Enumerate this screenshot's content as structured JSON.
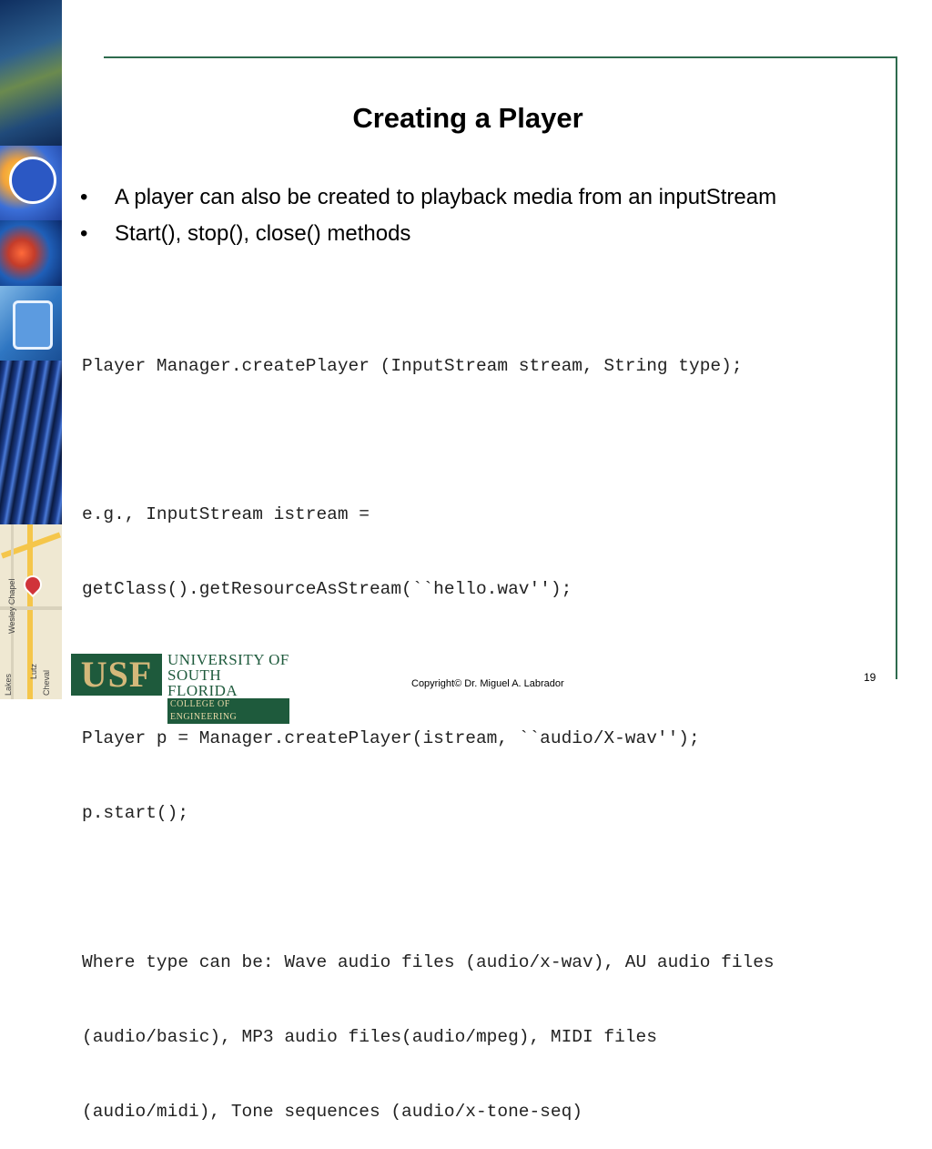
{
  "slide": {
    "title": "Creating a Player",
    "bullets": [
      "A player can also be created to playback media from an inputStream",
      "Start(), stop(), close() methods"
    ],
    "code_lines": [
      "Player Manager.createPlayer (InputStream stream, String type);",
      "",
      "e.g., InputStream istream =",
      "getClass().getResourceAsStream(``hello.wav'');",
      "",
      "Player p = Manager.createPlayer(istream, ``audio/X-wav'');",
      "p.start();",
      "",
      "Where type can be: Wave audio files (audio/x-wav), AU audio files",
      "(audio/basic), MP3 audio files(audio/mpeg), MIDI files",
      "(audio/midi), Tone sequences (audio/x-tone-seq)"
    ],
    "bullet_glyph": "•"
  },
  "footer": {
    "copyright": "Copyright© Dr. Miguel A. Labrador",
    "page_number": "19"
  },
  "logo": {
    "mark": "USF",
    "line1": "UNIVERSITY OF",
    "line2": "SOUTH FLORIDA",
    "line3": "COLLEGE OF ENGINEERING"
  },
  "side_strip": {
    "map_labels": [
      "Wesley Chapel",
      "Lutz",
      "Lakes",
      "Cheval"
    ],
    "icons": [
      "satellite-dish-icon",
      "brain-icon",
      "mobile-phone-icon",
      "circuit-board-icon",
      "map-pin-icon"
    ]
  },
  "colors": {
    "frame": "#2e6b4e",
    "usf_green": "#1e5a3c",
    "usf_gold": "#d4b87a"
  }
}
